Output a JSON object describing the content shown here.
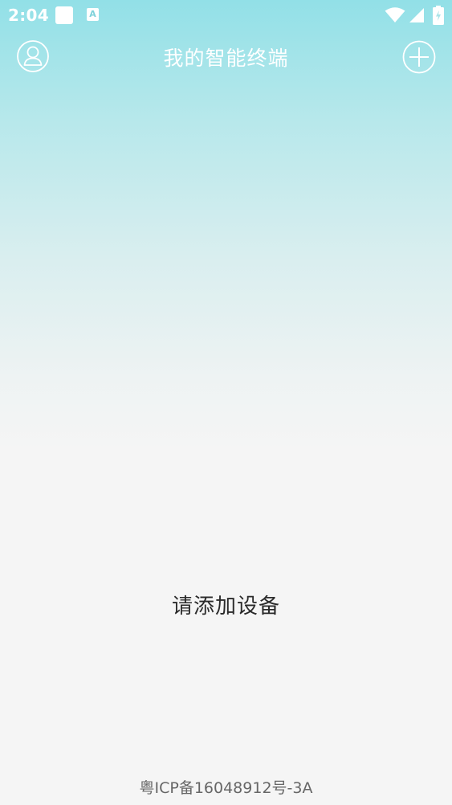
{
  "status_bar": {
    "time": "2:04",
    "notification_icons": [
      "app-notification-icon",
      "a-badge-icon"
    ],
    "notification_badge_letter": "A",
    "system_icons": [
      "wifi-icon",
      "signal-icon",
      "battery-charging-icon"
    ]
  },
  "header": {
    "title": "我的智能终端",
    "left_icon": "user-profile-icon",
    "right_icon": "add-circle-icon"
  },
  "main": {
    "empty_message": "请添加设备"
  },
  "footer": {
    "icp": "粤ICP备16048912号-3A"
  },
  "colors": {
    "header_gradient_top": "#92e0e7",
    "background": "#f5f5f5",
    "title_text": "#ffffff",
    "empty_text": "#2a2a2a",
    "footer_text": "#666666"
  }
}
